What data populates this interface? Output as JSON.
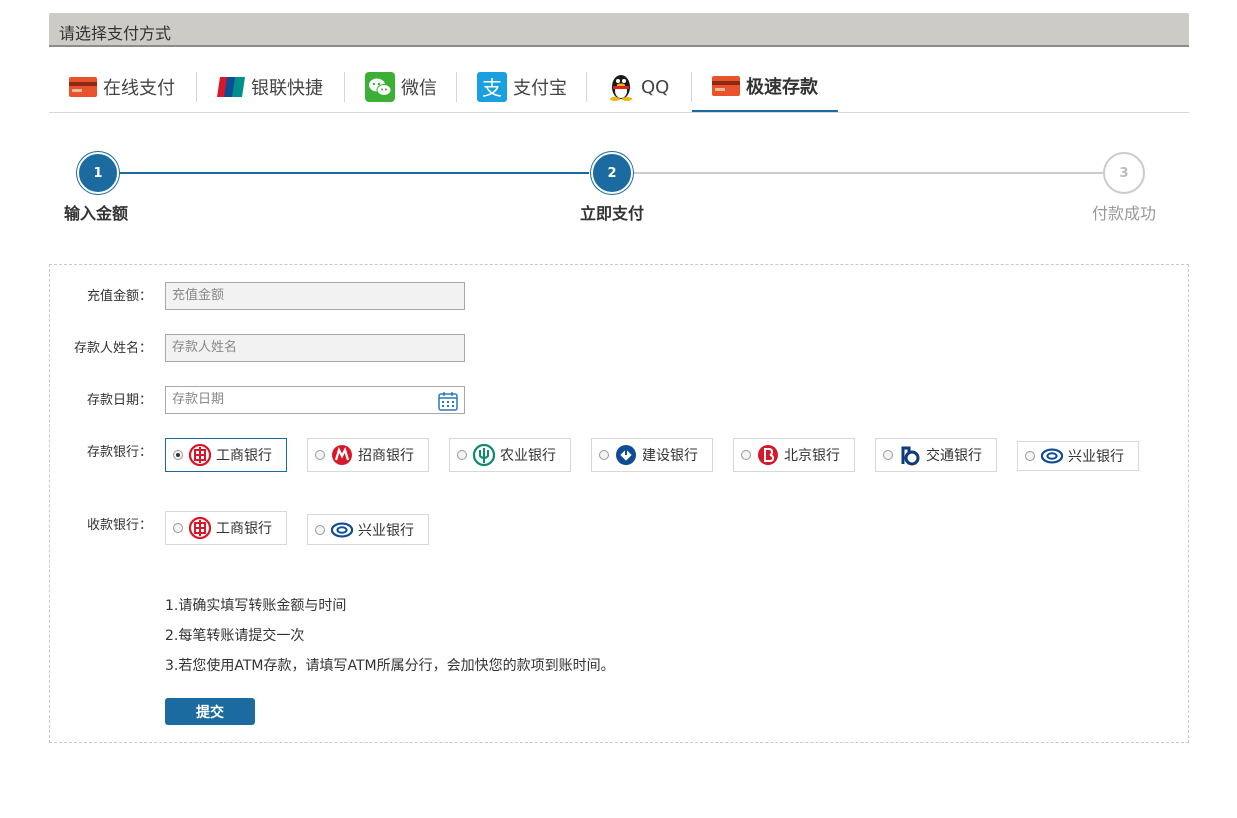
{
  "header": {
    "title": "请选择支付方式"
  },
  "tabs": [
    {
      "label": "在线支付",
      "icon": "card-icon"
    },
    {
      "label": "银联快捷",
      "icon": "unionpay-icon"
    },
    {
      "label": "微信",
      "icon": "wechat-icon"
    },
    {
      "label": "支付宝",
      "icon": "alipay-icon"
    },
    {
      "label": "QQ",
      "icon": "qq-penguin-icon"
    },
    {
      "label": "极速存款",
      "icon": "card-icon",
      "active": true
    }
  ],
  "steps": [
    {
      "num": "1",
      "label": "输入金额",
      "state": "done"
    },
    {
      "num": "2",
      "label": "立即支付",
      "state": "current"
    },
    {
      "num": "3",
      "label": "付款成功",
      "state": "todo"
    }
  ],
  "form": {
    "amount": {
      "label": "充值金额：",
      "placeholder": "充值金额"
    },
    "name": {
      "label": "存款人姓名：",
      "placeholder": "存款人姓名"
    },
    "date": {
      "label": "存款日期：",
      "placeholder": "存款日期"
    },
    "deposit_bank": {
      "label": "存款银行：",
      "options": [
        {
          "name": "工商银行",
          "selected": true
        },
        {
          "name": "招商银行",
          "selected": false
        },
        {
          "name": "农业银行",
          "selected": false
        },
        {
          "name": "建设银行",
          "selected": false
        },
        {
          "name": "北京银行",
          "selected": false
        },
        {
          "name": "交通银行",
          "selected": false
        },
        {
          "name": "兴业银行",
          "selected": false
        }
      ]
    },
    "receive_bank": {
      "label": "收款银行：",
      "options": [
        {
          "name": "工商银行",
          "selected": false
        },
        {
          "name": "兴业银行",
          "selected": false
        }
      ]
    },
    "notes": [
      "1.请确实填写转账金额与时间",
      "2.每笔转账请提交一次",
      "3.若您使用ATM存款，请填写ATM所属分行，会加快您的款项到账时间。"
    ],
    "submit_label": "提交"
  },
  "colors": {
    "accent": "#1b6aa0",
    "header_bg": "#cccbc6"
  }
}
